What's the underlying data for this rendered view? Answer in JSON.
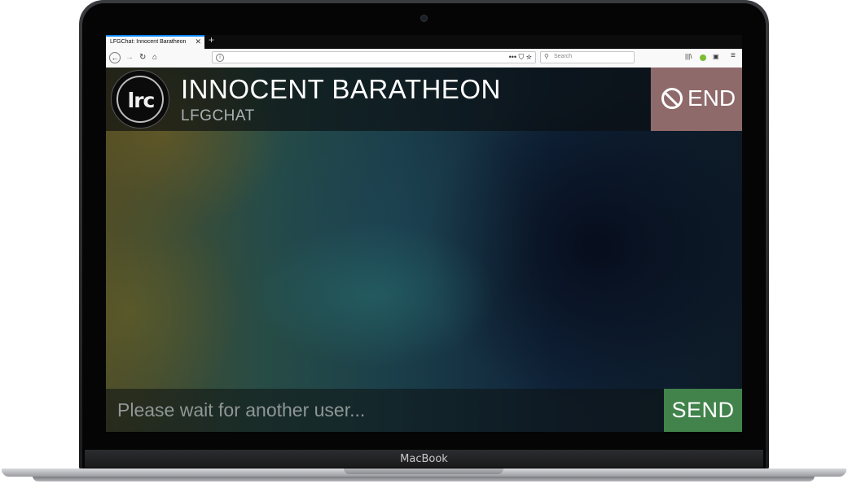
{
  "device": {
    "brand_label": "MacBook"
  },
  "browser": {
    "tab_title": "LFGChat: Innocent Baratheon",
    "tab_close": "✕",
    "new_tab": "+",
    "back": "←",
    "forward": "→",
    "reload": "↻",
    "home": "⌂",
    "url_info": "i",
    "url_actions": "•••  ⛉  ☆",
    "search_placeholder": "Search",
    "search_icon": "⚲",
    "library": "|||\\",
    "sidebar": "▣",
    "menu": "≡"
  },
  "app": {
    "logo_text": "lrc",
    "title": "INNOCENT BARATHEON",
    "subtitle": "LFGCHAT",
    "end_label": "END",
    "message_placeholder": "Please wait for another user...",
    "send_label": "SEND"
  },
  "colors": {
    "end_button": "#8f6a6a",
    "send_button": "#41834b",
    "tab_accent": "#0a84ff"
  }
}
